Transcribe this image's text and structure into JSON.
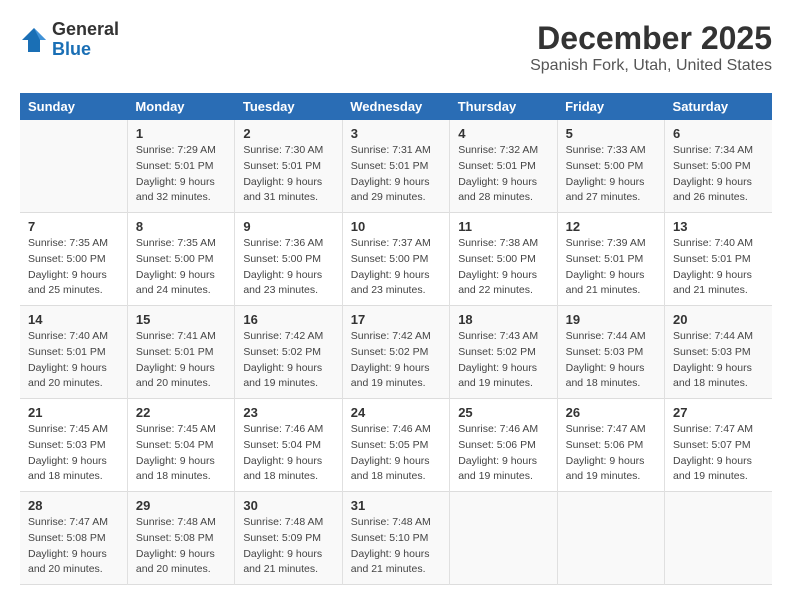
{
  "logo": {
    "general": "General",
    "blue": "Blue"
  },
  "title": {
    "month": "December 2025",
    "location": "Spanish Fork, Utah, United States"
  },
  "calendar": {
    "headers": [
      "Sunday",
      "Monday",
      "Tuesday",
      "Wednesday",
      "Thursday",
      "Friday",
      "Saturday"
    ],
    "weeks": [
      [
        {
          "day": "",
          "info": ""
        },
        {
          "day": "1",
          "info": "Sunrise: 7:29 AM\nSunset: 5:01 PM\nDaylight: 9 hours\nand 32 minutes."
        },
        {
          "day": "2",
          "info": "Sunrise: 7:30 AM\nSunset: 5:01 PM\nDaylight: 9 hours\nand 31 minutes."
        },
        {
          "day": "3",
          "info": "Sunrise: 7:31 AM\nSunset: 5:01 PM\nDaylight: 9 hours\nand 29 minutes."
        },
        {
          "day": "4",
          "info": "Sunrise: 7:32 AM\nSunset: 5:01 PM\nDaylight: 9 hours\nand 28 minutes."
        },
        {
          "day": "5",
          "info": "Sunrise: 7:33 AM\nSunset: 5:00 PM\nDaylight: 9 hours\nand 27 minutes."
        },
        {
          "day": "6",
          "info": "Sunrise: 7:34 AM\nSunset: 5:00 PM\nDaylight: 9 hours\nand 26 minutes."
        }
      ],
      [
        {
          "day": "7",
          "info": "Sunrise: 7:35 AM\nSunset: 5:00 PM\nDaylight: 9 hours\nand 25 minutes."
        },
        {
          "day": "8",
          "info": "Sunrise: 7:35 AM\nSunset: 5:00 PM\nDaylight: 9 hours\nand 24 minutes."
        },
        {
          "day": "9",
          "info": "Sunrise: 7:36 AM\nSunset: 5:00 PM\nDaylight: 9 hours\nand 23 minutes."
        },
        {
          "day": "10",
          "info": "Sunrise: 7:37 AM\nSunset: 5:00 PM\nDaylight: 9 hours\nand 23 minutes."
        },
        {
          "day": "11",
          "info": "Sunrise: 7:38 AM\nSunset: 5:00 PM\nDaylight: 9 hours\nand 22 minutes."
        },
        {
          "day": "12",
          "info": "Sunrise: 7:39 AM\nSunset: 5:01 PM\nDaylight: 9 hours\nand 21 minutes."
        },
        {
          "day": "13",
          "info": "Sunrise: 7:40 AM\nSunset: 5:01 PM\nDaylight: 9 hours\nand 21 minutes."
        }
      ],
      [
        {
          "day": "14",
          "info": "Sunrise: 7:40 AM\nSunset: 5:01 PM\nDaylight: 9 hours\nand 20 minutes."
        },
        {
          "day": "15",
          "info": "Sunrise: 7:41 AM\nSunset: 5:01 PM\nDaylight: 9 hours\nand 20 minutes."
        },
        {
          "day": "16",
          "info": "Sunrise: 7:42 AM\nSunset: 5:02 PM\nDaylight: 9 hours\nand 19 minutes."
        },
        {
          "day": "17",
          "info": "Sunrise: 7:42 AM\nSunset: 5:02 PM\nDaylight: 9 hours\nand 19 minutes."
        },
        {
          "day": "18",
          "info": "Sunrise: 7:43 AM\nSunset: 5:02 PM\nDaylight: 9 hours\nand 19 minutes."
        },
        {
          "day": "19",
          "info": "Sunrise: 7:44 AM\nSunset: 5:03 PM\nDaylight: 9 hours\nand 18 minutes."
        },
        {
          "day": "20",
          "info": "Sunrise: 7:44 AM\nSunset: 5:03 PM\nDaylight: 9 hours\nand 18 minutes."
        }
      ],
      [
        {
          "day": "21",
          "info": "Sunrise: 7:45 AM\nSunset: 5:03 PM\nDaylight: 9 hours\nand 18 minutes."
        },
        {
          "day": "22",
          "info": "Sunrise: 7:45 AM\nSunset: 5:04 PM\nDaylight: 9 hours\nand 18 minutes."
        },
        {
          "day": "23",
          "info": "Sunrise: 7:46 AM\nSunset: 5:04 PM\nDaylight: 9 hours\nand 18 minutes."
        },
        {
          "day": "24",
          "info": "Sunrise: 7:46 AM\nSunset: 5:05 PM\nDaylight: 9 hours\nand 18 minutes."
        },
        {
          "day": "25",
          "info": "Sunrise: 7:46 AM\nSunset: 5:06 PM\nDaylight: 9 hours\nand 19 minutes."
        },
        {
          "day": "26",
          "info": "Sunrise: 7:47 AM\nSunset: 5:06 PM\nDaylight: 9 hours\nand 19 minutes."
        },
        {
          "day": "27",
          "info": "Sunrise: 7:47 AM\nSunset: 5:07 PM\nDaylight: 9 hours\nand 19 minutes."
        }
      ],
      [
        {
          "day": "28",
          "info": "Sunrise: 7:47 AM\nSunset: 5:08 PM\nDaylight: 9 hours\nand 20 minutes."
        },
        {
          "day": "29",
          "info": "Sunrise: 7:48 AM\nSunset: 5:08 PM\nDaylight: 9 hours\nand 20 minutes."
        },
        {
          "day": "30",
          "info": "Sunrise: 7:48 AM\nSunset: 5:09 PM\nDaylight: 9 hours\nand 21 minutes."
        },
        {
          "day": "31",
          "info": "Sunrise: 7:48 AM\nSunset: 5:10 PM\nDaylight: 9 hours\nand 21 minutes."
        },
        {
          "day": "",
          "info": ""
        },
        {
          "day": "",
          "info": ""
        },
        {
          "day": "",
          "info": ""
        }
      ]
    ]
  }
}
